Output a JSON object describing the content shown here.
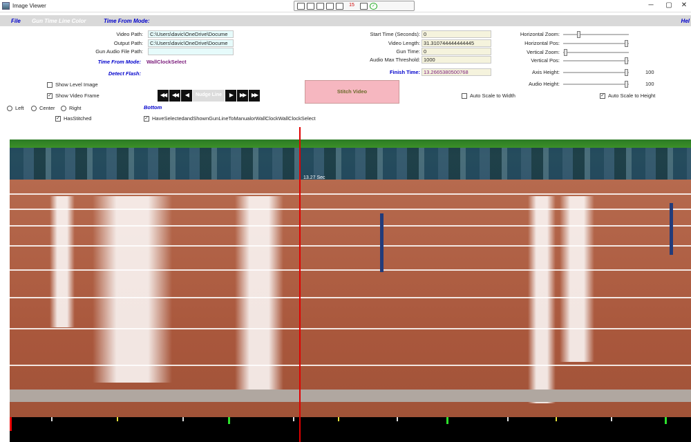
{
  "window": {
    "title": "Image Viewer",
    "minimize": "─",
    "maximize": "▢",
    "close": "✕"
  },
  "toolbar": {
    "icons": [
      "screenshot-icon",
      "window-icon",
      "monitor-icon",
      "fullscreen-icon",
      "pin-icon"
    ],
    "count": "15",
    "ok": "✓"
  },
  "menu": {
    "file": "File",
    "gun_color": "Gun Time Line Color",
    "time_mode": "Time From Mode:",
    "help": "Hel"
  },
  "paths": {
    "video_label": "Video Path:",
    "video_value": "C:\\Users\\davic\\OneDrive\\Docume",
    "output_label": "Output Path:",
    "output_value": "C:\\Users\\davic\\OneDrive\\Docume",
    "audio_label": "Gun Audio File Path:",
    "audio_value": ""
  },
  "mode": {
    "label": "Time From Mode:",
    "value": "WallClockSelect",
    "detect": "Detect Flash:"
  },
  "times": {
    "start_label": "Start Time (Seconds):",
    "start_value": "0",
    "length_label": "Video Length:",
    "length_value": "31.310744444444445",
    "gun_label": "Gun Time:",
    "gun_value": "0",
    "threshold_label": "Audio Max Threshold:",
    "threshold_value": "1000",
    "finish_label": "Finish Time:",
    "finish_value": "13.2665380500768"
  },
  "zoom": {
    "hzoom": "Horizontal Zoom:",
    "hpos": "Horizontal Pos:",
    "vzoom": "Vertical Zoom:",
    "vpos": "Vertical Pos:",
    "axis_label": "Axis Height:",
    "axis_value": "100",
    "audio_label": "Audio Height:",
    "audio_value": "100",
    "hzoom_level": 0.22,
    "hpos_level": 1.0,
    "vzoom_level": 0.0,
    "vpos_level": 1.0,
    "axis_level": 1.0,
    "audio_level": 1.0
  },
  "checks": {
    "level_image": "Show Level Image",
    "level_checked": false,
    "video_frame": "Show Video Frame",
    "video_checked": true,
    "has_stitched": "HasStitched",
    "has_stitched_checked": true,
    "have_selected": "HaveSelectedandShownGunLineToManualorWallClockWallClockSelect",
    "have_selected_checked": true,
    "auto_width": "Auto Scale to Width",
    "auto_width_checked": false,
    "auto_height": "Auto Scale to Height",
    "auto_height_checked": true
  },
  "align": {
    "left": "Left",
    "center": "Center",
    "right": "Right",
    "bottom": "Bottom"
  },
  "nav": {
    "first": "◀◀",
    "prev_fast": "◀◀",
    "prev": "◀",
    "nudge": "Nudge Line",
    "next": "▶",
    "next_fast": "▶▶",
    "last": "▶▶"
  },
  "stitch": "Stitch Video",
  "image": {
    "time_mark": "13.27 Sec"
  },
  "colors": {
    "accent": "#0000cc",
    "gun_line": "#e00000",
    "stitch_bg": "#f6b7c0"
  }
}
